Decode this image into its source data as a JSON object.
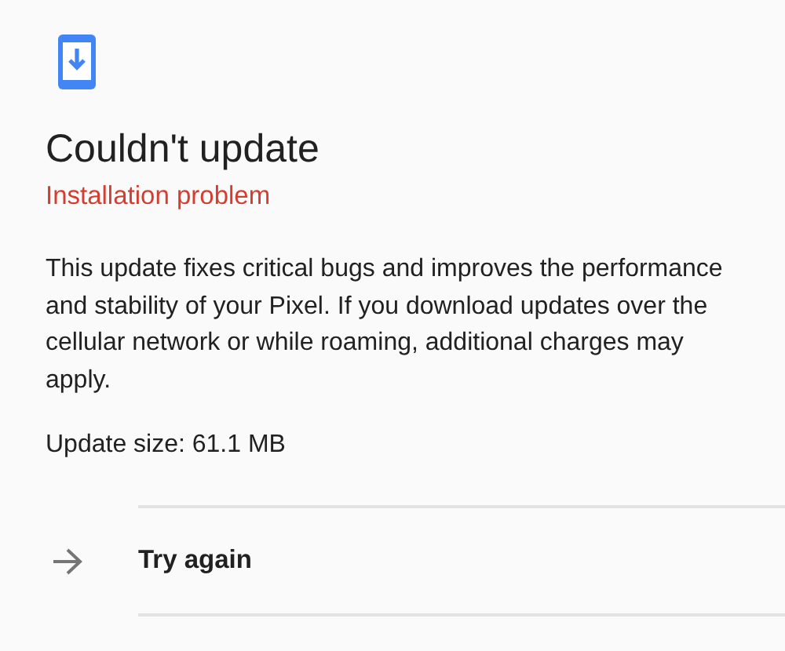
{
  "title": "Couldn't update",
  "subtitle": "Installation problem",
  "description": "This update fixes critical bugs and improves the performance and stability of your Pixel. If you download updates over the cellular network or while roaming, additional charges may apply.",
  "update_size": "Update size: 61.1 MB",
  "actions": [
    {
      "label": "Try again"
    }
  ]
}
